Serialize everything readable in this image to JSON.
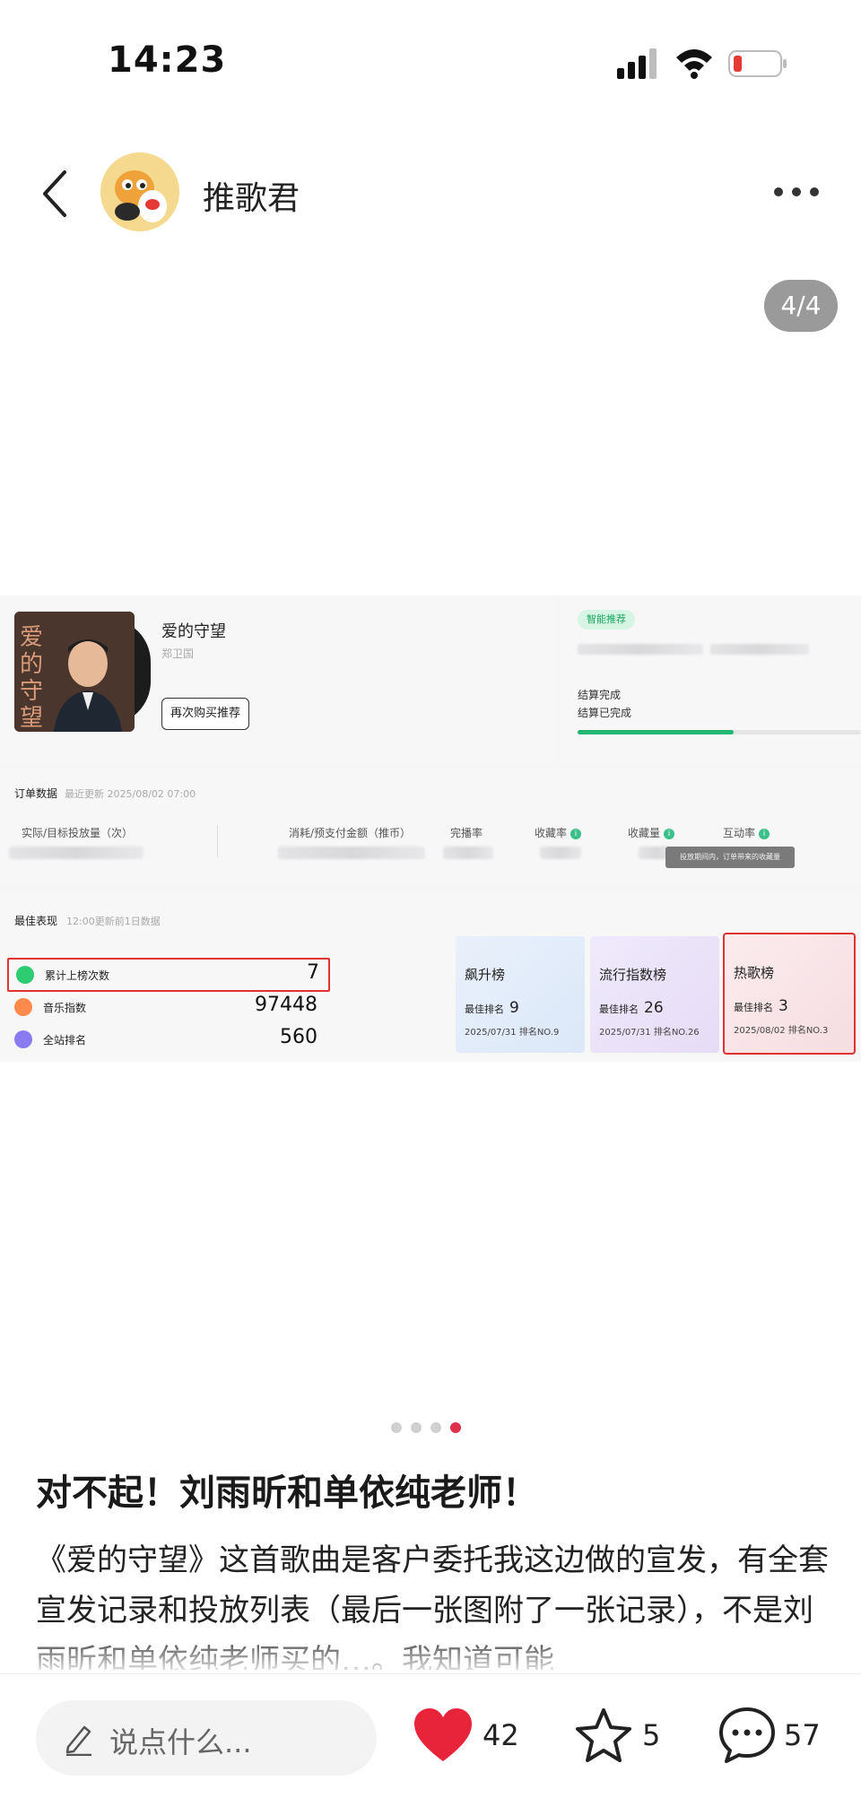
{
  "status_bar": {
    "time": "14:23"
  },
  "header": {
    "username": "推歌君"
  },
  "pager": {
    "label": "4/4"
  },
  "image": {
    "song_title": "爱的守望",
    "singer": "郑卫国",
    "cover_text": "爱的守望",
    "rebuy_button": "再次购买推荐",
    "smart_badge": "智能推荐",
    "settlement_1": "结算完成",
    "settlement_2": "结算已完成",
    "progress_fraction": 0.55,
    "order": {
      "title": "订单数据",
      "updated": "最近更新 2025/08/02 07:00",
      "col_1": "实际/目标投放量（次）",
      "col_2": "消耗/预支付金额（推币）",
      "col_3": "完播率",
      "col_4": "收藏率",
      "col_5": "收藏量",
      "col_6": "互动率",
      "tooltip": "投放期间内，订单带来的收藏量"
    },
    "best": {
      "title": "最佳表现",
      "updated": "12:00更新前1日数据",
      "stats": [
        {
          "label": "累计上榜次数",
          "value": "7"
        },
        {
          "label": "音乐指数",
          "value": "97448"
        },
        {
          "label": "全站排名",
          "value": "560"
        }
      ],
      "ranks": [
        {
          "name": "飙升榜",
          "best_label": "最佳排名",
          "best": "9",
          "date": "2025/07/31 排名NO.9"
        },
        {
          "name": "流行指数榜",
          "best_label": "最佳排名",
          "best": "26",
          "date": "2025/07/31 排名NO.26"
        },
        {
          "name": "热歌榜",
          "best_label": "最佳排名",
          "best": "3",
          "date": "2025/08/02 排名NO.3"
        }
      ]
    }
  },
  "post": {
    "title": "对不起！刘雨昕和单依纯老师！",
    "body": "《爱的守望》这首歌曲是客户委托我这边做的宣发，有全套宣发记录和投放列表（最后一张图附了一张记录），不是刘雨昕和单依纯老师买的…。我知道可能"
  },
  "bottom_bar": {
    "comment_placeholder": "说点什么...",
    "likes": "42",
    "favorites": "5",
    "comments": "57"
  },
  "colors": {
    "accent_red": "#e0304a",
    "green": "#22b573"
  }
}
